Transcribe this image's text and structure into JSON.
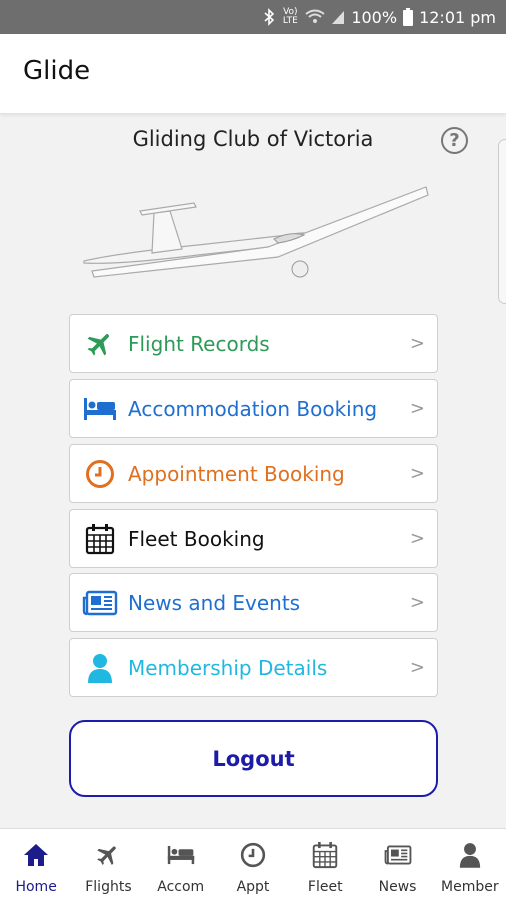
{
  "status_bar": {
    "battery": "100%",
    "time": "12:01 pm",
    "network": "Vo) LTE"
  },
  "app_bar": {
    "title": "Glide"
  },
  "header": {
    "club_name": "Gliding Club of Victoria",
    "help_symbol": "?"
  },
  "menu": {
    "chevron": ">",
    "items": [
      {
        "label": "Flight Records",
        "color": "#2e9a58",
        "icon": "airplane-icon"
      },
      {
        "label": "Accommodation Booking",
        "color": "#1f6fd1",
        "icon": "bed-icon"
      },
      {
        "label": "Appointment Booking",
        "color": "#e07020",
        "icon": "clock-icon"
      },
      {
        "label": "Fleet Booking",
        "color": "#111111",
        "icon": "calendar-icon"
      },
      {
        "label": "News and Events",
        "color": "#1f6fd1",
        "icon": "newspaper-icon"
      },
      {
        "label": "Membership Details",
        "color": "#20b8e0",
        "icon": "user-icon"
      }
    ]
  },
  "logout_label": "Logout",
  "bottom_nav": {
    "active_color": "#1c1c8a",
    "inactive_color": "#555555",
    "items": [
      {
        "label": "Home",
        "icon": "home-icon",
        "active": true
      },
      {
        "label": "Flights",
        "icon": "airplane-icon"
      },
      {
        "label": "Accom",
        "icon": "bed-icon"
      },
      {
        "label": "Appt",
        "icon": "clock-icon"
      },
      {
        "label": "Fleet",
        "icon": "calendar-icon"
      },
      {
        "label": "News",
        "icon": "newspaper-icon"
      },
      {
        "label": "Member",
        "icon": "user-icon"
      }
    ]
  }
}
